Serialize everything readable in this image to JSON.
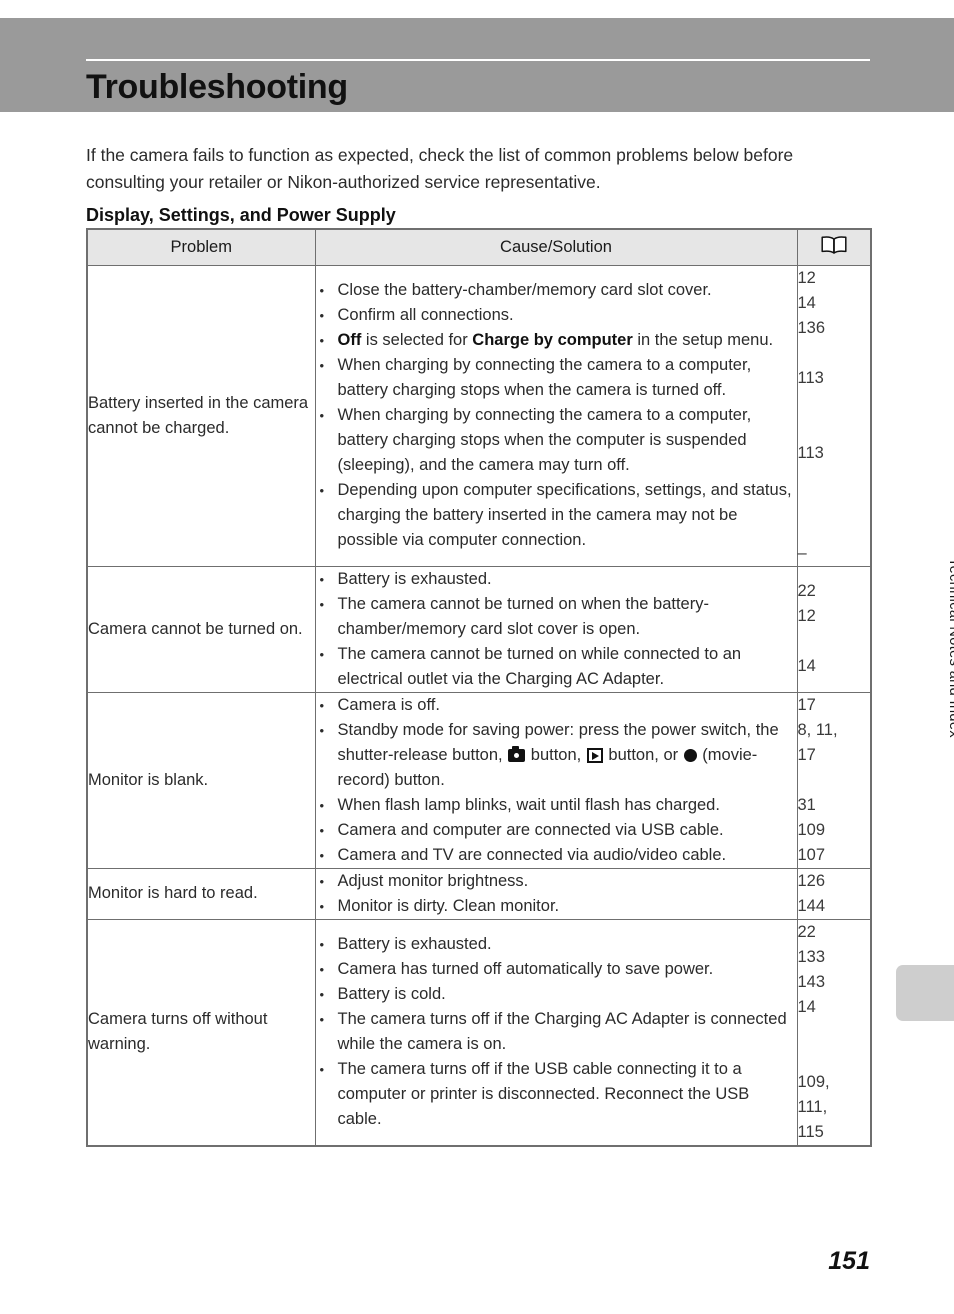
{
  "page": {
    "chapter_title": "Troubleshooting",
    "intro": "If the camera fails to function as expected, check the list of common problems below before consulting your retailer or Nikon-authorized service representative.",
    "section_heading": "Display, Settings, and Power Supply",
    "side_running_head": "Technical Notes and Index",
    "page_number": "151",
    "header_band_color": "#9a9a9a",
    "table_header_fill": "#e6e6e6",
    "edge_tab_color": "#cecece"
  },
  "table": {
    "headers": {
      "problem": "Problem",
      "cause_solution": "Cause/Solution",
      "reference_icon": "open-book-icon"
    },
    "rows": [
      {
        "problem": "Battery inserted in the camera cannot be charged.",
        "causes": [
          {
            "parts": [
              {
                "text": "Close the battery-chamber/memory card slot cover."
              }
            ]
          },
          {
            "parts": [
              {
                "text": "Confirm all connections."
              }
            ]
          },
          {
            "parts": [
              {
                "text": "Off",
                "bold": true
              },
              {
                "text": " is selected for "
              },
              {
                "text": "Charge by computer",
                "bold": true
              },
              {
                "text": " in the setup menu."
              }
            ]
          },
          {
            "parts": [
              {
                "text": "When charging by connecting the camera to a computer, battery charging stops when the camera is turned off."
              }
            ]
          },
          {
            "parts": [
              {
                "text": "When charging by connecting the camera to a computer, battery charging stops when the computer is suspended (sleeping), and the camera may turn off."
              }
            ]
          },
          {
            "parts": [
              {
                "text": "Depending upon computer specifications, settings, and status, charging the battery inserted in the camera may not be possible via computer connection."
              }
            ]
          }
        ],
        "pages": [
          "12",
          "14",
          "136",
          "",
          "113",
          "",
          "",
          "113",
          "",
          "",
          "",
          "–"
        ]
      },
      {
        "problem": "Camera cannot be turned on.",
        "causes": [
          {
            "parts": [
              {
                "text": "Battery is exhausted."
              }
            ]
          },
          {
            "parts": [
              {
                "text": "The camera cannot be turned on when the battery-chamber/memory card slot cover is open."
              }
            ]
          },
          {
            "parts": [
              {
                "text": "The camera cannot be turned on while connected to an electrical outlet via the Charging AC Adapter."
              }
            ]
          }
        ],
        "pages": [
          "22",
          "12",
          "",
          "14"
        ]
      },
      {
        "problem": "Monitor is blank.",
        "causes": [
          {
            "parts": [
              {
                "text": "Camera is off."
              }
            ]
          },
          {
            "parts": [
              {
                "text": "Standby mode for saving power: press the power switch, the shutter-release button, "
              },
              {
                "icon": "camera-shooting-mode-icon"
              },
              {
                "text": " button, "
              },
              {
                "icon": "playback-mode-icon"
              },
              {
                "text": " button, or "
              },
              {
                "icon": "movie-record-icon"
              },
              {
                "text": " (movie-record) button."
              }
            ]
          },
          {
            "parts": [
              {
                "text": "When flash lamp blinks, wait until flash has charged."
              }
            ]
          },
          {
            "parts": [
              {
                "text": "Camera and computer are connected via USB cable."
              }
            ]
          },
          {
            "parts": [
              {
                "text": "Camera and TV are connected via audio/video cable."
              }
            ]
          }
        ],
        "pages": [
          "17",
          "8, 11,",
          "17",
          "",
          "31",
          "109",
          "107"
        ]
      },
      {
        "problem": "Monitor is hard to read.",
        "causes": [
          {
            "parts": [
              {
                "text": "Adjust monitor brightness."
              }
            ]
          },
          {
            "parts": [
              {
                "text": "Monitor is dirty. Clean monitor."
              }
            ]
          }
        ],
        "pages": [
          "126",
          "144"
        ]
      },
      {
        "problem": "Camera turns off without warning.",
        "causes": [
          {
            "parts": [
              {
                "text": "Battery is exhausted."
              }
            ]
          },
          {
            "parts": [
              {
                "text": "Camera has turned off automatically to save power."
              }
            ]
          },
          {
            "parts": [
              {
                "text": "Battery is cold."
              }
            ]
          },
          {
            "parts": [
              {
                "text": "The camera turns off if the Charging AC Adapter is connected while the camera is on."
              }
            ]
          },
          {
            "parts": [
              {
                "text": "The camera turns off if the USB cable connecting it to a computer or printer is disconnected. Reconnect the USB cable."
              }
            ]
          }
        ],
        "pages": [
          "22",
          "133",
          "143",
          "14",
          "",
          "",
          "109,",
          "111,",
          "115"
        ]
      }
    ]
  }
}
